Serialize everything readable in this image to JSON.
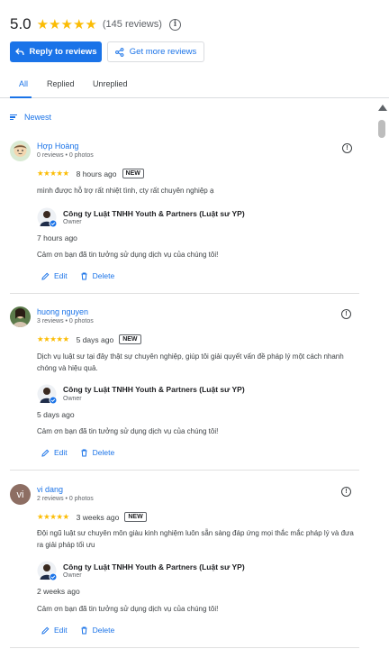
{
  "header": {
    "rating": "5.0",
    "stars": "★★★★★",
    "review_count": "(145 reviews)",
    "info_glyph": "i"
  },
  "buttons": {
    "reply": "Reply to reviews",
    "get_more": "Get more reviews"
  },
  "tabs": [
    "All",
    "Replied",
    "Unreplied"
  ],
  "sort_label": "Newest",
  "colors": {
    "accent": "#1a73e8",
    "star": "#fbbc04"
  },
  "reviews": [
    {
      "name": "Hợp Hoàng",
      "meta": "0 reviews • 0 photos",
      "stars": "★★★★★",
      "time": "8 hours ago",
      "badge": "NEW",
      "text": "mình được hỗ trợ rất nhiệt tình, cty rất chuyên nghiệp ạ",
      "owner": {
        "name": "Công ty Luật TNHH Youth & Partners (Luật sư YP)",
        "role": "Owner",
        "time": "7 hours ago",
        "reply": "Cảm ơn bạn đã tin tưởng sử dụng dịch vụ của chúng tôi!"
      },
      "edit": "Edit",
      "delete": "Delete"
    },
    {
      "name": "huong nguyen",
      "meta": "3 reviews • 0 photos",
      "stars": "★★★★★",
      "time": "5 days ago",
      "badge": "NEW",
      "text": "Dịch vụ luật sư tại đây thật sự chuyên nghiệp, giúp tôi giải quyết vấn đề pháp lý một cách nhanh chóng và hiệu quả.",
      "owner": {
        "name": "Công ty Luật TNHH Youth & Partners (Luật sư YP)",
        "role": "Owner",
        "time": "5 days ago",
        "reply": "Cảm ơn bạn đã tin tưởng sử dụng dịch vụ của chúng tôi!"
      },
      "edit": "Edit",
      "delete": "Delete"
    },
    {
      "name": "vi dang",
      "avatar_letter": "vi",
      "meta": "2 reviews • 0 photos",
      "stars": "★★★★★",
      "time": "3 weeks ago",
      "badge": "NEW",
      "text": "Đội ngũ luật sư chuyên môn giàu kinh nghiệm luôn sẵn sàng đáp ứng mọi thắc mắc pháp lý và đưa ra giải pháp tối ưu",
      "owner": {
        "name": "Công ty Luật TNHH Youth & Partners (Luật sư YP)",
        "role": "Owner",
        "time": "2 weeks ago",
        "reply": "Cảm ơn bạn đã tin tưởng sử dụng dịch vụ của chúng tôi!"
      },
      "edit": "Edit",
      "delete": "Delete"
    }
  ]
}
